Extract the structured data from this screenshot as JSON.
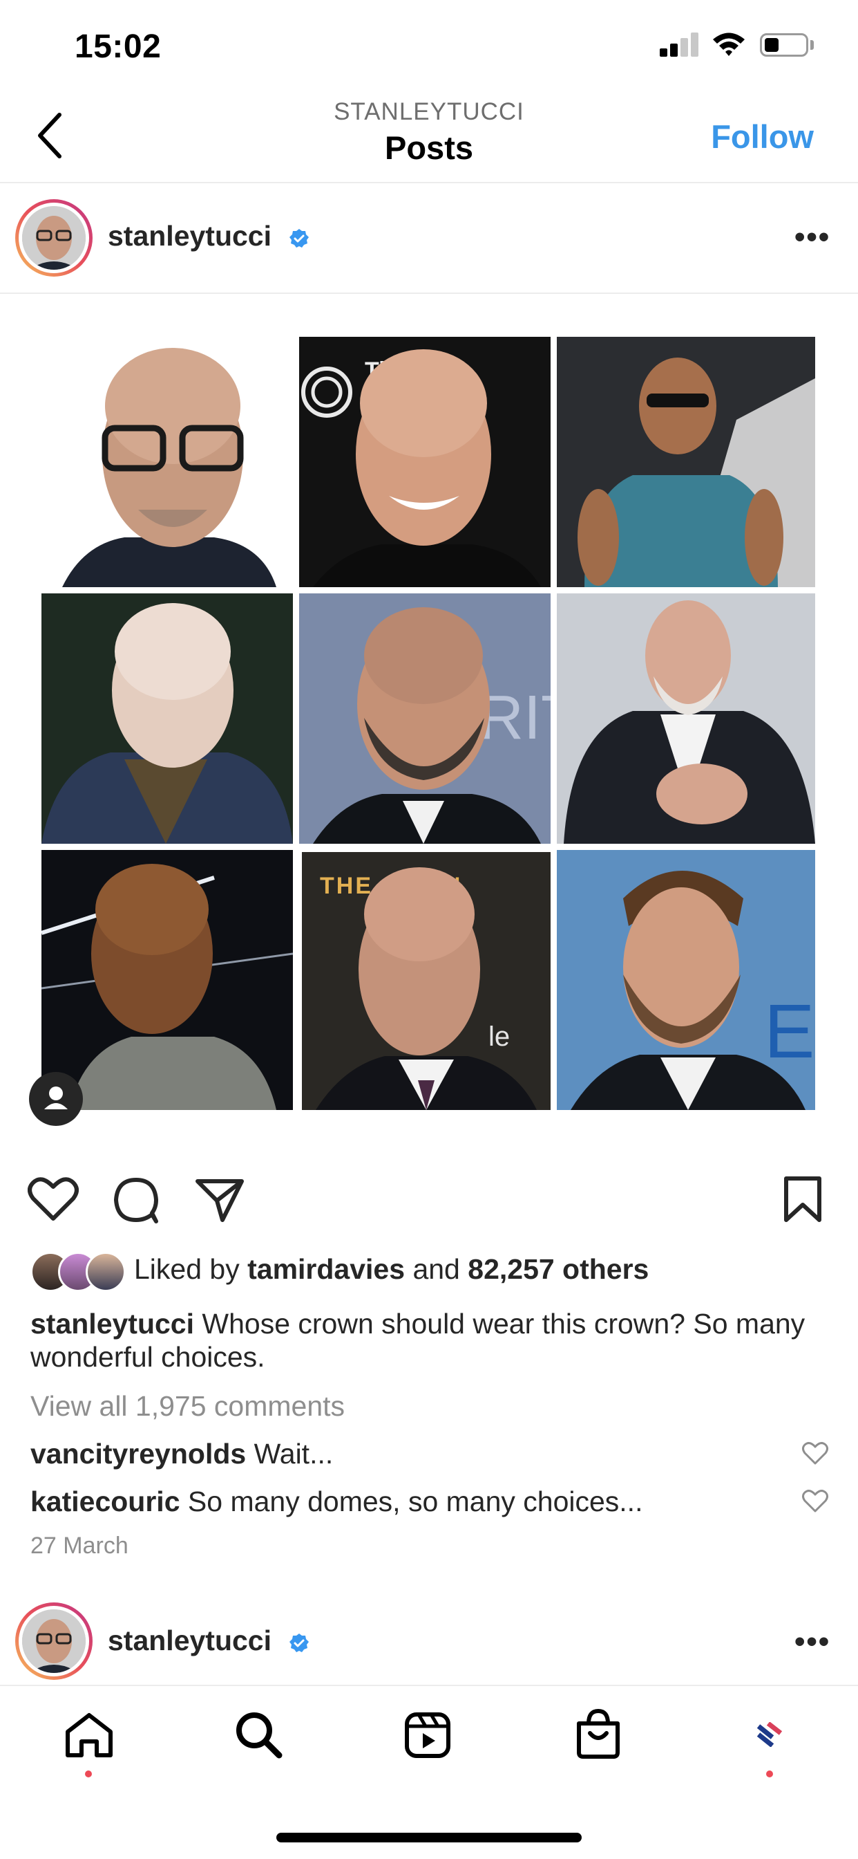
{
  "status_bar": {
    "time": "15:02",
    "battery_level": 0.35
  },
  "header": {
    "username": "STANLEYTUCCI",
    "title": "Posts",
    "follow_label": "Follow"
  },
  "post": {
    "author": "stanleytucci",
    "verified": true,
    "likes": {
      "prefix": "Liked by",
      "liker": "tamirdavies",
      "conjunction": "and",
      "others": "82,257 others"
    },
    "caption": {
      "author": "stanleytucci",
      "text": "Whose crown should wear this crown? So many wonderful choices."
    },
    "view_comments": "View all 1,975 comments",
    "comments": [
      {
        "author": "vancityreynolds",
        "text": "Wait..."
      },
      {
        "author": "katiecouric",
        "text": "So many domes, so many choices..."
      }
    ],
    "date": "27 March",
    "image_text": {
      "tile_2": "Tim",
      "tile_8": "THE     ATION",
      "tile_8b": "le"
    }
  },
  "next_post": {
    "author": "stanleytucci",
    "verified": true
  },
  "nav": {
    "items": [
      {
        "icon": "home-icon",
        "badge": true
      },
      {
        "icon": "search-icon",
        "badge": false
      },
      {
        "icon": "reels-icon",
        "badge": false
      },
      {
        "icon": "shop-icon",
        "badge": false
      },
      {
        "icon": "profile-icon",
        "badge": true
      }
    ]
  },
  "colors": {
    "accent": "#3a96e8",
    "verified": "#3897f0",
    "notification": "#ed4956",
    "text": "#262626",
    "muted": "#8e8e8e"
  }
}
